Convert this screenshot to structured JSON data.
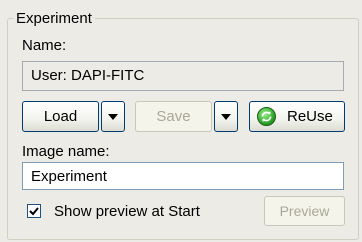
{
  "experiment_group": {
    "title": "Experiment",
    "name_label": "Name:",
    "name_value": "User: DAPI-FITC",
    "load_label": "Load",
    "save_label": "Save",
    "reuse_label": "ReUse",
    "image_name_label": "Image name:",
    "image_name_value": "Experiment",
    "show_preview_label": "Show preview at Start",
    "show_preview_checked": true,
    "preview_label": "Preview"
  },
  "icons": {
    "load_dropdown": "chevron-down-icon",
    "save_dropdown": "chevron-down-icon",
    "reuse": "green-recycle-icon",
    "checkbox": "check-icon"
  },
  "colors": {
    "background": "#ecebe6",
    "button_border": "#003c74",
    "input_border": "#7f9db9",
    "disabled_text": "#a9a798",
    "reuse_icon": "#2fa62a"
  }
}
